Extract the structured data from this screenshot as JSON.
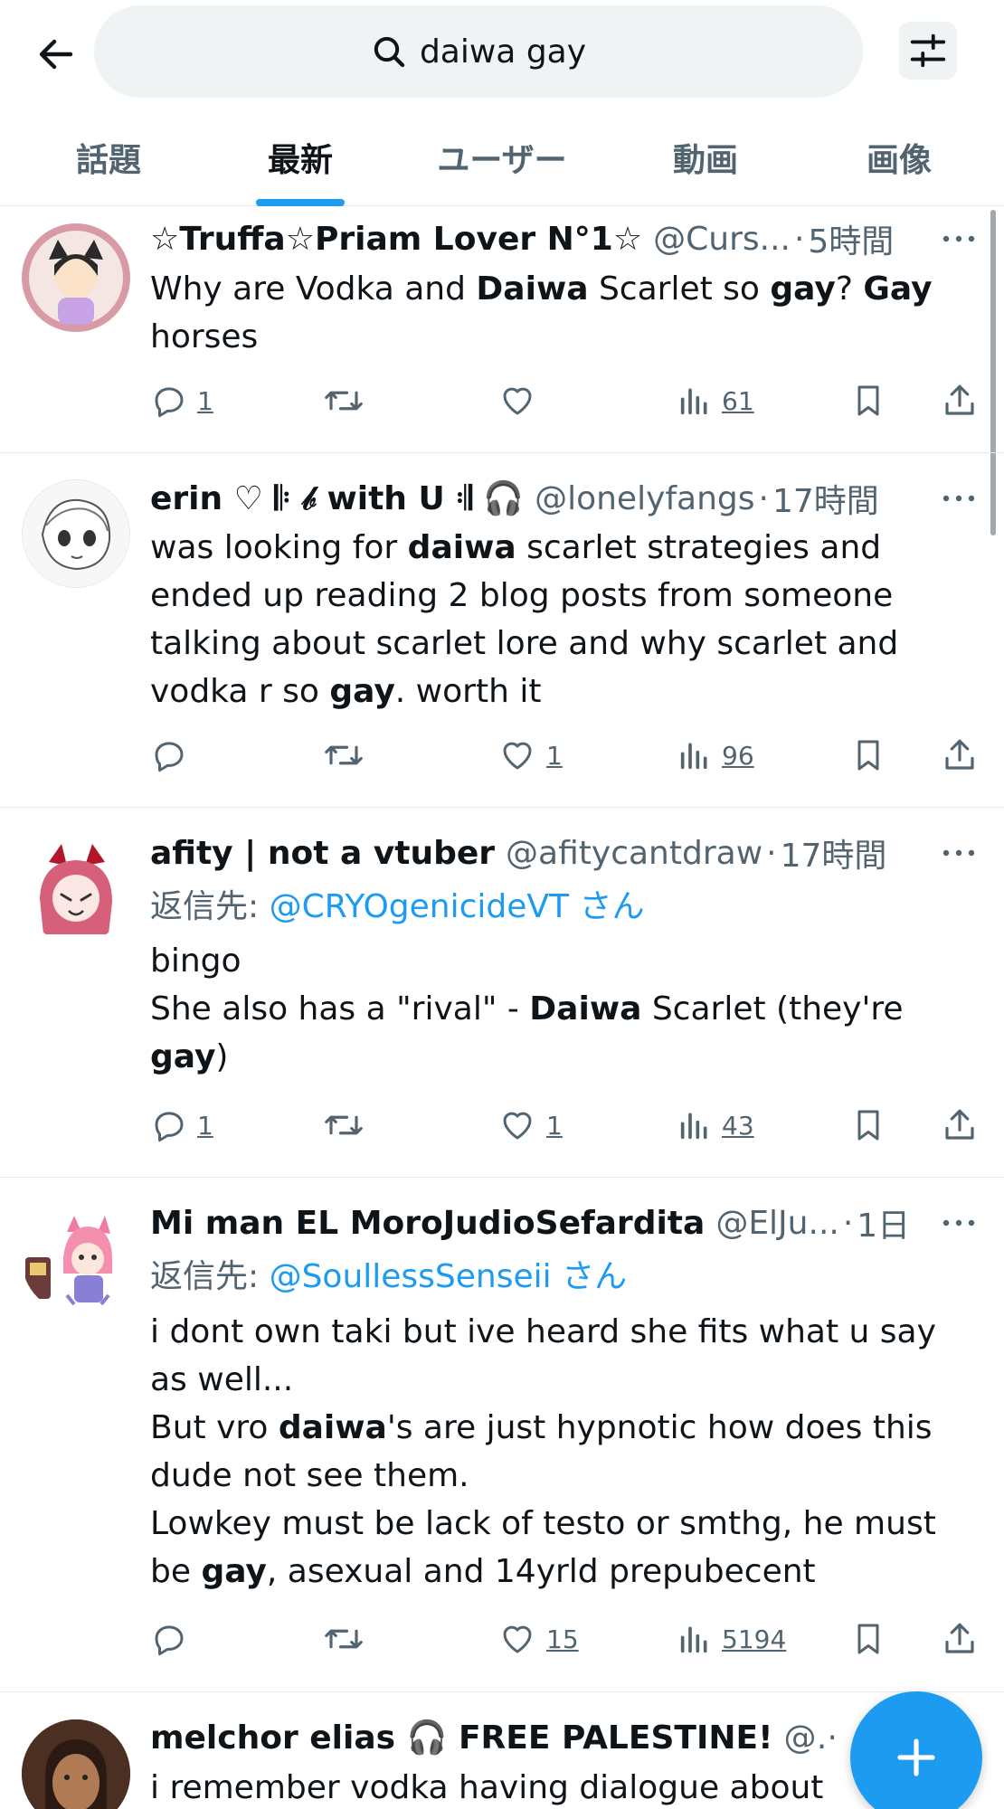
{
  "search": {
    "query": "daiwa gay"
  },
  "tabs": [
    {
      "label": "話題"
    },
    {
      "label": "最新"
    },
    {
      "label": "ユーザー"
    },
    {
      "label": "動画"
    },
    {
      "label": "画像"
    }
  ],
  "active_tab": "最新",
  "colors": {
    "accent": "#1d9bf0",
    "muted": "#536471",
    "text": "#0f1419"
  },
  "tweets": [
    {
      "name": "☆Truffa☆Priam Lover N°1☆",
      "handle": "@Curs...",
      "dot": "·",
      "time": "5時間",
      "body_parts": [
        {
          "t": "Why are Vodka and "
        },
        {
          "t": "Daiwa",
          "b": true
        },
        {
          "t": " Scarlet so "
        },
        {
          "t": "gay",
          "b": true
        },
        {
          "t": "? "
        },
        {
          "t": "Gay",
          "b": true
        },
        {
          "t": " horses"
        }
      ],
      "replies": "1",
      "retweets": "",
      "likes": "",
      "views": "61"
    },
    {
      "name": "erin ♡ 𝄆 𝒷 with U 𝄇 🎧",
      "handle": "@lonelyfangs",
      "dot": "·",
      "time": "17時間",
      "body_parts": [
        {
          "t": "was looking for "
        },
        {
          "t": "daiwa",
          "b": true
        },
        {
          "t": " scarlet strategies and ended up reading 2 blog posts from someone talking about scarlet lore and why scarlet and vodka r so "
        },
        {
          "t": "gay",
          "b": true
        },
        {
          "t": ". worth it"
        }
      ],
      "replies": "",
      "retweets": "",
      "likes": "1",
      "views": "96"
    },
    {
      "name": "afity | not a vtuber",
      "handle": "@afitycantdraw",
      "dot": "·",
      "time": "17時間",
      "reply_prefix": "返信先: ",
      "reply_to": "@CRYOgenicideVT さん",
      "body_parts": [
        {
          "t": "bingo"
        },
        {
          "br": true
        },
        {
          "t": "She also has a \"rival\" - "
        },
        {
          "t": "Daiwa",
          "b": true
        },
        {
          "t": " Scarlet (they're "
        },
        {
          "t": "gay",
          "b": true
        },
        {
          "t": ")"
        }
      ],
      "replies": "1",
      "retweets": "",
      "likes": "1",
      "views": "43"
    },
    {
      "name": "Mi man EL MoroJudioSefardita",
      "handle": "@ElJu...",
      "dot": "·",
      "time": "1日",
      "reply_prefix": "返信先: ",
      "reply_to": "@SoullessSenseii さん",
      "body_parts": [
        {
          "t": "i dont own taki but ive heard she fits what u say as well..."
        },
        {
          "br": true
        },
        {
          "t": "But vro "
        },
        {
          "t": "daiwa",
          "b": true
        },
        {
          "t": "'s are just hypnotic how does this dude not see them."
        },
        {
          "br": true
        },
        {
          "t": "Lowkey must be lack of testo or smthg, he must be "
        },
        {
          "t": "gay",
          "b": true
        },
        {
          "t": ", asexual and 14yrld prepubecent"
        }
      ],
      "replies": "",
      "retweets": "",
      "likes": "15",
      "views": "5194"
    },
    {
      "name": "melchor elias 🎧 FREE PALESTINE!",
      "handle": "@...",
      "dot": "·",
      "time": "",
      "body_parts": [
        {
          "t": "i remember vodka having dialogue about"
        }
      ]
    }
  ],
  "icons": {
    "back": "arrow-left-icon",
    "search": "search-icon",
    "filter": "sliders-icon",
    "more": "more-horizontal-icon",
    "reply": "reply-icon",
    "retweet": "retweet-icon",
    "like": "heart-icon",
    "views": "views-icon",
    "bookmark": "bookmark-icon",
    "share": "share-icon",
    "compose": "plus-icon"
  }
}
